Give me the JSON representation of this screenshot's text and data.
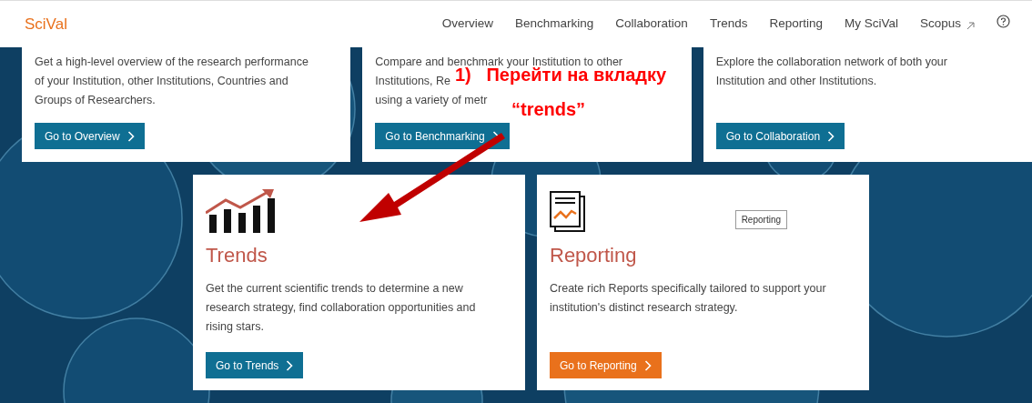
{
  "header": {
    "logo": "SciVal",
    "nav": [
      {
        "label": "Overview",
        "external": false
      },
      {
        "label": "Benchmarking",
        "external": false
      },
      {
        "label": "Collaboration",
        "external": false
      },
      {
        "label": "Trends",
        "external": false
      },
      {
        "label": "Reporting",
        "external": false
      },
      {
        "label": "My SciVal",
        "external": false
      },
      {
        "label": "Scopus",
        "external": true
      }
    ]
  },
  "top_cards": [
    {
      "description": "Get a high-level overview of the research performance of your Institution, other Institutions, Countries and Groups of Researchers.",
      "button": "Go to Overview"
    },
    {
      "lines": [
        "Compare and benchmark your Institution to other",
        "Institutions, Re",
        "using a variety of metr"
      ],
      "button": "Go to Benchmarking"
    },
    {
      "description": "Explore the collaboration network of both your Institution and other Institutions.",
      "button": "Go to Collaboration"
    }
  ],
  "feature_cards": [
    {
      "kind": "trends",
      "title": "Trends",
      "description": "Get the current scientific trends to determine a new research strategy, find collaboration opportunities and rising stars.",
      "button": "Go to Trends"
    },
    {
      "kind": "reporting",
      "title": "Reporting",
      "tooltip": "Reporting",
      "description": "Create rich Reports specifically tailored to support your institution's distinct research strategy.",
      "button": "Go to Reporting"
    }
  ],
  "annotation": {
    "line1": "1)   Перейти на вкладку",
    "line2": "“trends”"
  }
}
